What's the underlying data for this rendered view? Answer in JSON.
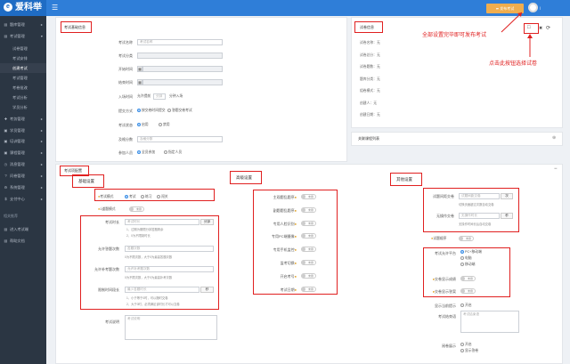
{
  "app": {
    "logo_text": "爱科举",
    "logo_mark": "e"
  },
  "topbar": {
    "menu_icon": "☰",
    "publish_label": "➦ 发布考试",
    "username": "|"
  },
  "sidebar": {
    "items": [
      {
        "icon": "▤",
        "label": "题库管理",
        "arrow": "▸"
      },
      {
        "icon": "▤",
        "label": "考试管理",
        "arrow": "▾"
      },
      {
        "label": "试卷管理"
      },
      {
        "label": "考试安排"
      },
      {
        "label": "创建考试"
      },
      {
        "label": "考试管理"
      },
      {
        "label": "考卷批改"
      },
      {
        "label": "考试分析"
      },
      {
        "label": "学员分析"
      },
      {
        "icon": "✚",
        "label": "考务管理",
        "arrow": "▸"
      },
      {
        "icon": "▣",
        "label": "学员管理",
        "arrow": "▸"
      },
      {
        "icon": "▣",
        "label": "培训管理",
        "arrow": "▸"
      },
      {
        "icon": "▣",
        "label": "课程管理",
        "arrow": "▸"
      },
      {
        "icon": "◷",
        "label": "消息管理",
        "arrow": "▸"
      },
      {
        "icon": "?",
        "label": "问卷管理",
        "arrow": "▸"
      },
      {
        "icon": "⚙",
        "label": "系统管理",
        "arrow": "▸"
      },
      {
        "icon": "$",
        "label": "支付中心",
        "arrow": "▸"
      }
    ],
    "section_label": "相关推荐",
    "bottom_items": [
      {
        "icon": "▤",
        "label": "进入考试端"
      },
      {
        "icon": "▤",
        "label": "帮助文档"
      }
    ]
  },
  "basic": {
    "title": "考试基础信息",
    "fields": [
      {
        "label": "考试名称",
        "placeholder": "考试名称"
      },
      {
        "label": "考试分类",
        "placeholder": ""
      },
      {
        "label": "开始时间",
        "placeholder": ""
      },
      {
        "label": "结束时间",
        "placeholder": ""
      },
      {
        "label": "入场时间",
        "placeholder": "允许提前"
      },
      {
        "label": "提交方式",
        "placeholder": ""
      },
      {
        "label": "考试状态",
        "placeholder": ""
      },
      {
        "label": "及格分数",
        "placeholder": "及格分数"
      },
      {
        "label": "参加人员",
        "placeholder": ""
      }
    ],
    "calendar_icon": "▦",
    "entry_unit1": "分钟",
    "entry_unit2": "分钟入场",
    "submit_opts": [
      "按交卷时间提交",
      "答题交卷考试"
    ],
    "status_opts": [
      "启用",
      "禁用"
    ],
    "people_opts": [
      "全员参加",
      "指定人员"
    ]
  },
  "paper_info": {
    "title": "试卷信息",
    "add_icon": "□",
    "close_icon": "✖",
    "refresh_icon": "⟳",
    "rows": [
      {
        "k": "试卷名称：",
        "v": "无"
      },
      {
        "k": "试卷总分：",
        "v": "无"
      },
      {
        "k": "试卷题数：",
        "v": "无"
      },
      {
        "k": "题库分类：",
        "v": "无"
      },
      {
        "k": "组卷模式：",
        "v": "无"
      },
      {
        "k": "创建人：",
        "v": "无"
      },
      {
        "k": "创建日期：",
        "v": "无"
      }
    ]
  },
  "annotations": {
    "publish": "全部设置完毕即可发布考试",
    "choose": "点击此按钮选择试卷"
  },
  "course_panel": {
    "title": "关联课程列表",
    "icon": "⊕"
  },
  "config": {
    "title": "考试项配置",
    "collapse": "−",
    "basic_title": "基础设置",
    "mode_label": "考试模式",
    "mode_opts": [
      "考试",
      "练习",
      "闯关"
    ],
    "one_question_label": "1道题模式",
    "rows": [
      {
        "label": "考试时长",
        "value": "考试时长",
        "btn": "分钟"
      },
      {
        "label": "允许答题次数",
        "value": "答题次数",
        "btn": ""
      },
      {
        "label": "允许补考题次数",
        "value": "允许补考题次数",
        "btn": ""
      },
      {
        "label": "限制时间段长",
        "value": "最少答题时长",
        "btn": "秒"
      }
    ],
    "hint1": "1、过期为期限分钟答题剩余",
    "hint2": "2、0为不限制时长",
    "hint3": "0为不限次数，大于0为最高答题次数",
    "hint4": "0为不限次数，大于0为最高补考次数",
    "hint5": "1、小于等于0时，可以随时交卷",
    "hint6": "2、大于0时，必须满足该时长才可以交卷",
    "desc_label": "考试说明",
    "desc_placeholder": "考试说明",
    "high_title": "高级设置",
    "high_rows": [
      "主观题乱题序",
      "副题题乱题序",
      "专用人脸识别",
      "专用PC端摄像",
      "专用手机监控",
      "监考切换",
      "开启考号",
      "考试日期"
    ],
    "toggle_text": "未授",
    "other_title": "其他设置",
    "other_rows": [
      {
        "label": "试题间距交卷",
        "value": "试题间距交卷",
        "btn": "次"
      },
      {
        "label": "无操作交卷",
        "value": "无操作时长",
        "btn": "秒"
      }
    ],
    "other_hint1": "切换页面超过次数自动交卷",
    "other_hint2": "无操作时间长后自动交卷",
    "show_score_label": "试题顺序",
    "platform_label": "考试允许平台",
    "platform_opts": [
      "PC+移动端",
      "电脑",
      "移动端"
    ],
    "answer_show_label": "交卷显示成绩",
    "answer_key_label": "交卷显示答案",
    "notice_label": "显示当前提示",
    "notice_value": "开启",
    "finish_label": "考试结束语",
    "finish_placeholder": "考试结束语",
    "reveal_label": "阅卷展示",
    "reveal_opts": [
      "开启",
      "显示答卷"
    ]
  }
}
